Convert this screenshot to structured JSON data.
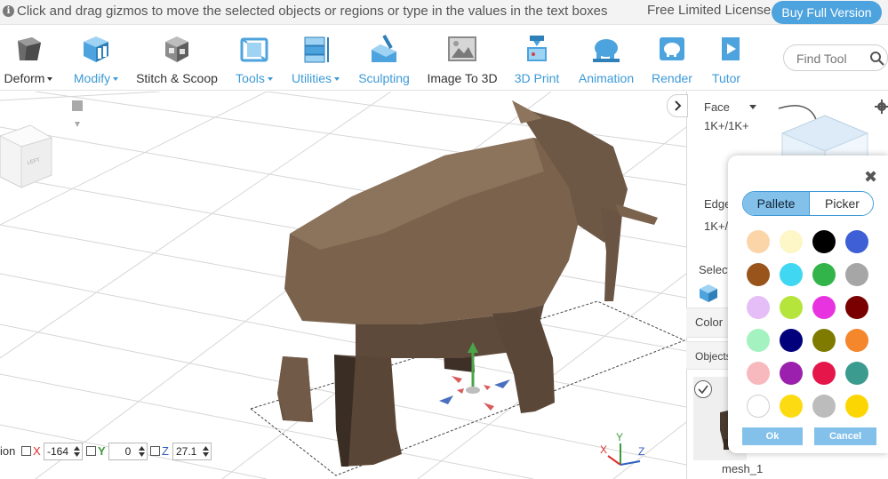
{
  "infobar": {
    "tip": "Click and drag gizmos to move the selected objects or regions or type in the values in the text boxes",
    "license": "Free Limited License",
    "buy_button": "Buy Full Version"
  },
  "toolbar": {
    "tools": [
      {
        "label": "Deform",
        "has_menu": true,
        "icon": "deform-icon"
      },
      {
        "label": "Modify",
        "has_menu": true,
        "icon": "modify-icon"
      },
      {
        "label": "Stitch & Scoop",
        "has_menu": false,
        "icon": "stitch-scoop-icon"
      },
      {
        "label": "Tools",
        "has_menu": true,
        "icon": "tools-icon"
      },
      {
        "label": "Utilities",
        "has_menu": true,
        "icon": "utilities-icon"
      },
      {
        "label": "Sculpting",
        "has_menu": false,
        "icon": "sculpting-icon"
      },
      {
        "label": "Image To 3D",
        "has_menu": false,
        "icon": "image-to-3d-icon"
      },
      {
        "label": "3D Print",
        "has_menu": false,
        "icon": "3d-print-icon"
      },
      {
        "label": "Animation",
        "has_menu": false,
        "icon": "animation-icon"
      },
      {
        "label": "Render",
        "has_menu": false,
        "icon": "render-icon"
      },
      {
        "label": "Tutor",
        "has_menu": false,
        "icon": "tutorials-icon"
      }
    ],
    "find_tool_placeholder": "Find Tool"
  },
  "viewport": {
    "position_label": "ion",
    "x_label": "X",
    "x_value": "-164",
    "y_label": "Y",
    "y_value": "0",
    "z_label": "Z",
    "z_value": "27.1",
    "axis_x": "X",
    "axis_y": "Y",
    "axis_z": "Z",
    "viewcube_face": "LEFT"
  },
  "rightpanel": {
    "face_label": "Face",
    "face_value": "1K+/1K+",
    "edge_label": "Edge",
    "edge_value": "1K+/",
    "select_label": "Select",
    "color_label": "Color",
    "objects_label": "Objects",
    "object_name": "mesh_1"
  },
  "color_picker": {
    "tabs": [
      "Pallete",
      "Picker"
    ],
    "active_tab": "Pallete",
    "swatches": [
      "#fbd4a8",
      "#fdf6c6",
      "#000000",
      "#3e5fd6",
      "#99541c",
      "#3fd7f2",
      "#32b44a",
      "#a6a6a6",
      "#e5bdf7",
      "#b5e43b",
      "#e833e0",
      "#7a0000",
      "#a3f2bf",
      "#02007a",
      "#7e7b00",
      "#f4862c",
      "#f7b9bd",
      "#9b20ae",
      "#e4164a",
      "#3b9b8e",
      "#ffffff",
      "#fcdb12",
      "#bcbcbc",
      "#fcd603"
    ],
    "ok_label": "Ok",
    "cancel_label": "Cancel"
  },
  "colors": {
    "accent": "#3d9ad6",
    "accent_light": "#84c1ea"
  }
}
